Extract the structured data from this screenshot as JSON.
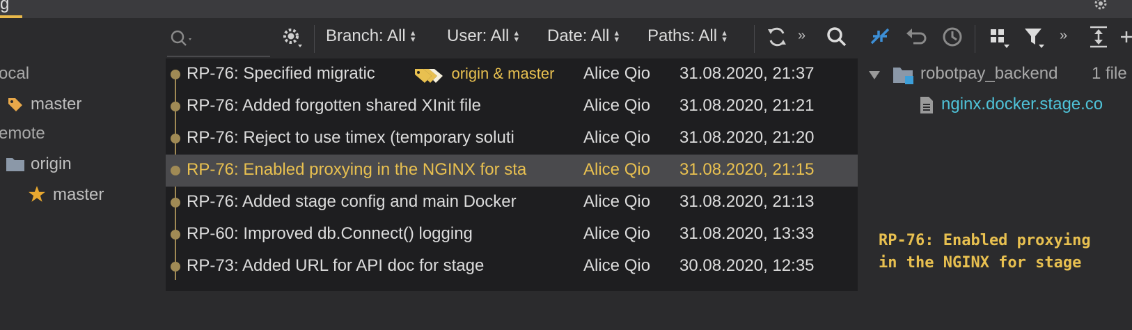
{
  "top": {
    "tab_label": "g",
    "accent": "#e8b84a"
  },
  "branches": {
    "local_label": "ocal",
    "local_master": "master",
    "remote_label": "emote",
    "origin_label": "origin",
    "origin_master": "master"
  },
  "toolbar": {
    "search_placeholder": "",
    "branch_filter": "Branch: All",
    "user_filter": "User: All",
    "date_filter": "Date: All",
    "paths_filter": "Paths: All",
    "more": "»"
  },
  "commits": [
    {
      "message": "RP-76: Specified migratic",
      "refs": "origin & master",
      "author": "Alice Qio",
      "date": "31.08.2020, 21:37"
    },
    {
      "message": "RP-76: Added forgotten shared XInit file",
      "author": "Alice Qio",
      "date": "31.08.2020, 21:21"
    },
    {
      "message": "RP-76: Reject to use timex (temporary soluti",
      "author": "Alice Qio",
      "date": "31.08.2020, 21:20"
    },
    {
      "message": "RP-76: Enabled proxying in the NGINX for sta",
      "author": "Alice Qio",
      "date": "31.08.2020, 21:15",
      "selected": true
    },
    {
      "message": "RP-76: Added stage config and main Docker",
      "author": "Alice Qio",
      "date": "31.08.2020, 21:13"
    },
    {
      "message": "RP-60: Improved db.Connect() logging",
      "author": "Alice Qio",
      "date": "31.08.2020, 13:33"
    },
    {
      "message": "RP-73: Added URL for API doc for stage",
      "author": "Alice Qio",
      "date": "30.08.2020, 12:35"
    }
  ],
  "changes": {
    "folder": "robotpay_backend",
    "count": "1 file",
    "file": "nginx.docker.stage.co"
  },
  "detail": {
    "line1": "RP-76: Enabled proxying",
    "line2": "in the NGINX for stage"
  },
  "colors": {
    "highlight": "#e8c050",
    "file_link": "#4fc3d9",
    "selection_bg": "#4a4a4d",
    "table_bg": "#1e1e20",
    "graph": "#a08a55"
  }
}
